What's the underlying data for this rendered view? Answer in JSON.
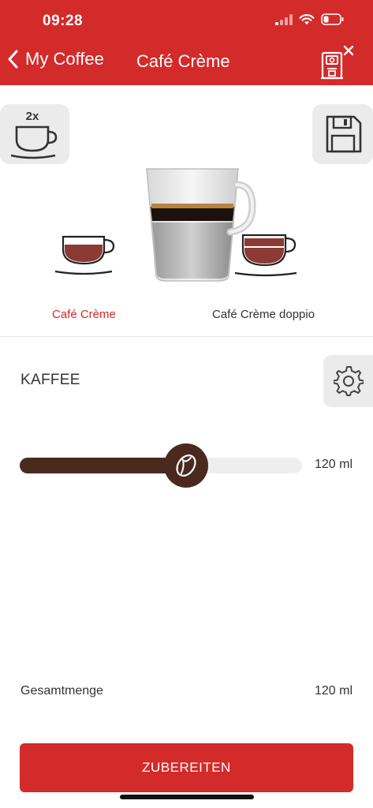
{
  "status_bar": {
    "time": "09:28"
  },
  "nav": {
    "back_label": "My Coffee",
    "title": "Café Crème"
  },
  "double_button": {
    "label": "2x"
  },
  "variants": {
    "selected_label": "Café Crème",
    "other_label": "Café Crème doppio"
  },
  "section": {
    "title": "KAFFEE"
  },
  "slider": {
    "fraction": 0.59,
    "value_label": "120 ml"
  },
  "total": {
    "label": "Gesamtmenge",
    "value": "120 ml"
  },
  "prepare_button": {
    "label": "ZUBEREITEN"
  },
  "colors": {
    "accent": "#d32a2a",
    "coffee": "#4a2a1f",
    "panel": "#ebebeb"
  },
  "icons": [
    "back-chevron-icon",
    "coffee-machine-remove-icon",
    "cup-icon",
    "save-icon",
    "gear-icon",
    "coffee-bean-icon",
    "signal-icon",
    "wifi-icon",
    "battery-icon"
  ]
}
